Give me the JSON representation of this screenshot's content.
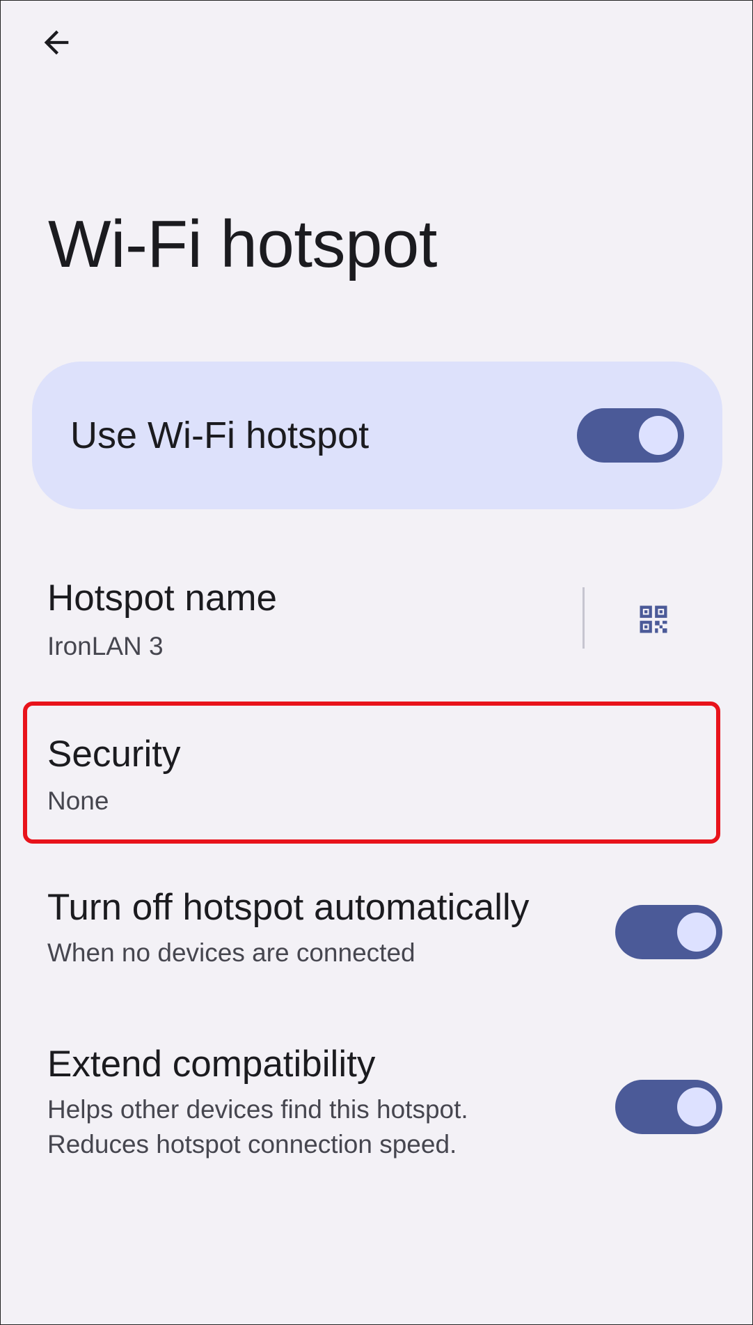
{
  "header": {
    "title": "Wi-Fi hotspot",
    "back_icon": "arrow-back-icon"
  },
  "main_toggle": {
    "label": "Use Wi-Fi hotspot",
    "enabled": true
  },
  "settings": {
    "hotspot_name": {
      "title": "Hotspot name",
      "value": "IronLAN 3",
      "action_icon": "qr-code-icon"
    },
    "security": {
      "title": "Security",
      "value": "None"
    },
    "auto_off": {
      "title": "Turn off hotspot automatically",
      "subtitle": "When no devices are connected",
      "enabled": true
    },
    "extend_compat": {
      "title": "Extend compatibility",
      "subtitle_line1": "Helps other devices find this hotspot.",
      "subtitle_line2": "Reduces hotspot connection speed.",
      "enabled": true
    }
  },
  "colors": {
    "background": "#f3f1f6",
    "card": "#dde1fb",
    "switch_track": "#4b5a98",
    "switch_thumb": "#dde1ff",
    "accent": "#4b5a98",
    "highlight": "#e8131b"
  }
}
